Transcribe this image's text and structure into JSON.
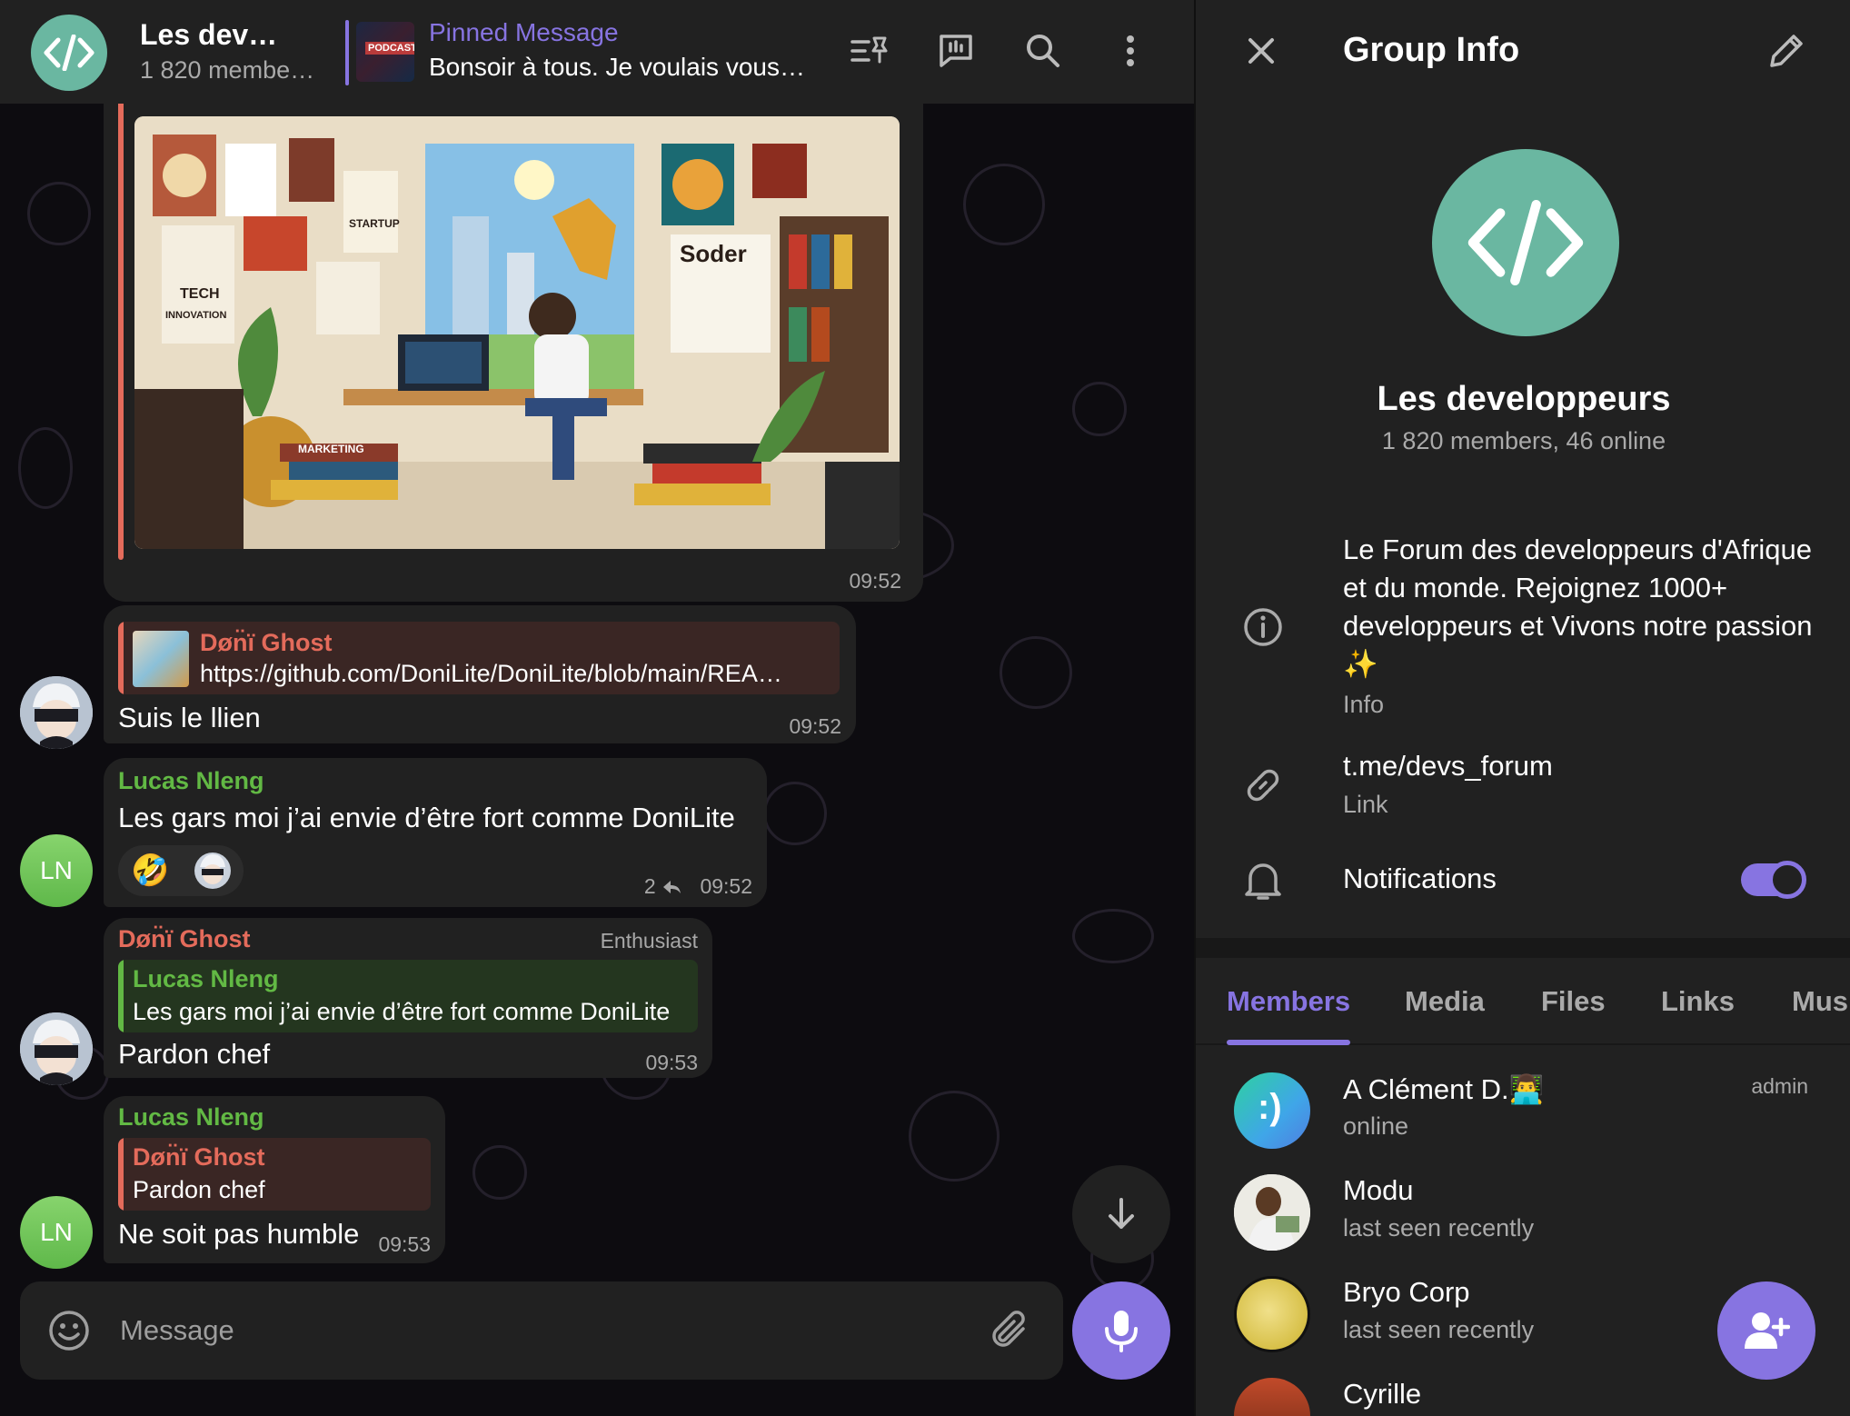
{
  "chat": {
    "header": {
      "title": "Les dev…",
      "subtitle": "1 820 membe…",
      "pinned_label": "Pinned Message",
      "pinned_text": "Bonsoir à tous. Je voulais vous…",
      "pinned_thumb_text": "PODCAST"
    },
    "messages": [
      {
        "type": "image",
        "image_desc": "illustration",
        "image_words": [
          "TECH",
          "INNOVATION",
          "STARTUP",
          "MARKETING",
          "Soder"
        ],
        "time": "09:52"
      },
      {
        "reply_sender": "Døn̈ï Ghost",
        "reply_text": "https://github.com/DoniLite/DoniLite/blob/main/REA…",
        "text": "Suis le llien",
        "time": "09:52"
      },
      {
        "sender": "Lucas Nleng",
        "text": "Les gars moi j’ai envie d’être fort comme DoniLite",
        "reactions": [
          "🤣",
          "avatar"
        ],
        "reply_count": "2",
        "time": "09:52"
      },
      {
        "sender": "Døn̈ï Ghost",
        "badge": "Enthusiast",
        "reply_sender": "Lucas Nleng",
        "reply_text": "Les gars moi j’ai envie d’être fort comme DoniLite",
        "text": "Pardon chef",
        "time": "09:53"
      },
      {
        "sender": "Lucas Nleng",
        "reply_sender": "Døn̈ï Ghost",
        "reply_text": "Pardon chef",
        "text": "Ne soit pas humble",
        "time": "09:53"
      }
    ],
    "avatars": {
      "ln": "LN"
    },
    "composer": {
      "placeholder": "Message"
    }
  },
  "panel": {
    "title": "Group Info",
    "group_name": "Les developpeurs",
    "group_stats": "1 820 members, 46 online",
    "description": "Le Forum des developpeurs d'Afrique et du monde. Rejoignez 1000+ developpeurs et Vivons notre passion ✨",
    "description_label": "Info",
    "link": "t.me/devs_forum",
    "link_label": "Link",
    "notifications_label": "Notifications",
    "notifications_on": true,
    "tabs": [
      "Members",
      "Media",
      "Files",
      "Links",
      "Mus"
    ],
    "active_tab": "Members",
    "members": [
      {
        "name": "A Clément D.👨‍💻",
        "status": "online",
        "role": "admin"
      },
      {
        "name": "Modu",
        "status": "last seen recently",
        "role": ""
      },
      {
        "name": "Bryo Corp",
        "status": "last seen recently",
        "role": ""
      },
      {
        "name": "Cyrille",
        "status": "",
        "role": ""
      }
    ]
  },
  "colors": {
    "accent": "#8774e1",
    "group_avatar": "#6ab7a1",
    "sender_green": "#62b944",
    "sender_red": "#e46b5b",
    "bubble": "#212121"
  },
  "icons": [
    "code-icon",
    "pin-list-icon",
    "chat-bubble-icon",
    "search-icon",
    "more-vert-icon",
    "close-icon",
    "edit-icon",
    "info-circle-icon",
    "link-icon",
    "bell-icon",
    "emoji-icon",
    "attach-icon",
    "mic-icon",
    "arrow-down-icon",
    "add-member-icon"
  ]
}
